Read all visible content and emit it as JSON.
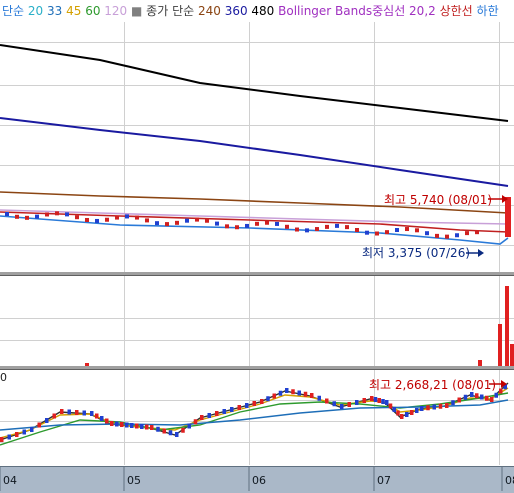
{
  "legend": {
    "items": [
      {
        "text": "단순",
        "color": "#2a7ad8"
      },
      {
        "text": "20",
        "color": "#2ab0c8"
      },
      {
        "text": "33",
        "color": "#1e6eb8"
      },
      {
        "text": "45",
        "color": "#d4a000"
      },
      {
        "text": "60",
        "color": "#2e9a2e"
      },
      {
        "text": "120",
        "color": "#c8a0d8"
      },
      {
        "text": "■",
        "color": "#808080"
      },
      {
        "text": "종가",
        "color": "#404040"
      },
      {
        "text": "단순",
        "color": "#404040"
      },
      {
        "text": "240",
        "color": "#8b4513"
      },
      {
        "text": "360",
        "color": "#1a1aa0"
      },
      {
        "text": "480",
        "color": "#000000"
      },
      {
        "text": "Bollinger Bands중심선 20,2",
        "color": "#a030c0"
      },
      {
        "text": "상한선",
        "color": "#c02020"
      },
      {
        "text": "하한",
        "color": "#2a7ad8"
      }
    ]
  },
  "chart_data": [
    {
      "type": "line",
      "title": "",
      "series": [
        {
          "name": "480",
          "color": "#000000",
          "x": [
            0,
            100,
            200,
            300,
            400,
            508
          ],
          "values": [
            45,
            60,
            83,
            96,
            108,
            121
          ]
        },
        {
          "name": "360",
          "color": "#1a1aa0",
          "x": [
            0,
            100,
            200,
            300,
            400,
            508
          ],
          "values": [
            118,
            130,
            141,
            155,
            170,
            186
          ]
        },
        {
          "name": "240",
          "color": "#8b4513",
          "x": [
            0,
            100,
            200,
            300,
            400,
            508
          ],
          "values": [
            192,
            196,
            199,
            203,
            207,
            213
          ]
        },
        {
          "name": "Bollinger Bands중심선 20,2",
          "color": "#c8a0d8",
          "x": [
            0,
            100,
            200,
            300,
            400,
            508
          ],
          "values": [
            210,
            213,
            216,
            219,
            222,
            224
          ]
        },
        {
          "name": "상한선",
          "color": "#c02020",
          "x": [
            0,
            120,
            250,
            380,
            460,
            508
          ],
          "values": [
            212,
            216,
            220,
            224,
            230,
            232
          ]
        },
        {
          "name": "하한",
          "color": "#2a7ad8",
          "x": [
            0,
            120,
            250,
            380,
            460,
            500,
            508
          ],
          "values": [
            216,
            225,
            228,
            233,
            240,
            244,
            238
          ]
        }
      ],
      "annotations": [
        {
          "text": "최고 5,740 (08/01)",
          "color": "#c00000"
        },
        {
          "text": "최저 3,375 (07/26)",
          "color": "#0a2a80"
        }
      ]
    },
    {
      "type": "bar",
      "title": "",
      "volume_bars": [
        {
          "x": 85,
          "h": 3
        },
        {
          "x": 478,
          "h": 6
        },
        {
          "x": 498,
          "h": 42
        },
        {
          "x": 505,
          "h": 80
        },
        {
          "x": 510,
          "h": 22
        }
      ]
    },
    {
      "type": "line",
      "title": "",
      "ylabel": "0",
      "xlabels": [
        "04",
        "05",
        "06",
        "07",
        "08"
      ],
      "annotations": [
        {
          "text": "최고 2,668,21 (08/01)",
          "color": "#c00000"
        }
      ],
      "series": [
        {
          "name": "index",
          "color": "#303030",
          "x": [
            0,
            30,
            60,
            90,
            110,
            130,
            150,
            175,
            200,
            230,
            260,
            285,
            310,
            340,
            370,
            385,
            400,
            420,
            445,
            470,
            490,
            508
          ],
          "values": [
            440,
            430,
            412,
            414,
            424,
            426,
            428,
            435,
            418,
            410,
            402,
            391,
            396,
            407,
            399,
            403,
            417,
            409,
            406,
            395,
            400,
            383
          ]
        },
        {
          "name": "ma-short",
          "color": "#d4a000",
          "x": [
            0,
            30,
            60,
            90,
            110,
            130,
            150,
            175,
            200,
            230,
            260,
            285,
            310,
            340,
            370,
            385,
            400,
            420,
            445,
            470,
            490,
            508
          ],
          "values": [
            438,
            430,
            415,
            414,
            422,
            426,
            428,
            430,
            420,
            412,
            404,
            395,
            397,
            405,
            401,
            402,
            412,
            410,
            406,
            398,
            399,
            388
          ]
        },
        {
          "name": "ma-mid",
          "color": "#2e9a2e",
          "x": [
            0,
            40,
            80,
            120,
            160,
            200,
            240,
            280,
            320,
            360,
            400,
            440,
            480,
            508
          ],
          "values": [
            445,
            432,
            420,
            422,
            430,
            425,
            412,
            404,
            402,
            404,
            408,
            404,
            398,
            393
          ]
        },
        {
          "name": "ma-long",
          "color": "#1e6eb8",
          "x": [
            0,
            60,
            120,
            180,
            240,
            300,
            360,
            420,
            480,
            508
          ],
          "values": [
            430,
            425,
            424,
            425,
            420,
            413,
            408,
            407,
            405,
            400
          ]
        }
      ]
    }
  ]
}
